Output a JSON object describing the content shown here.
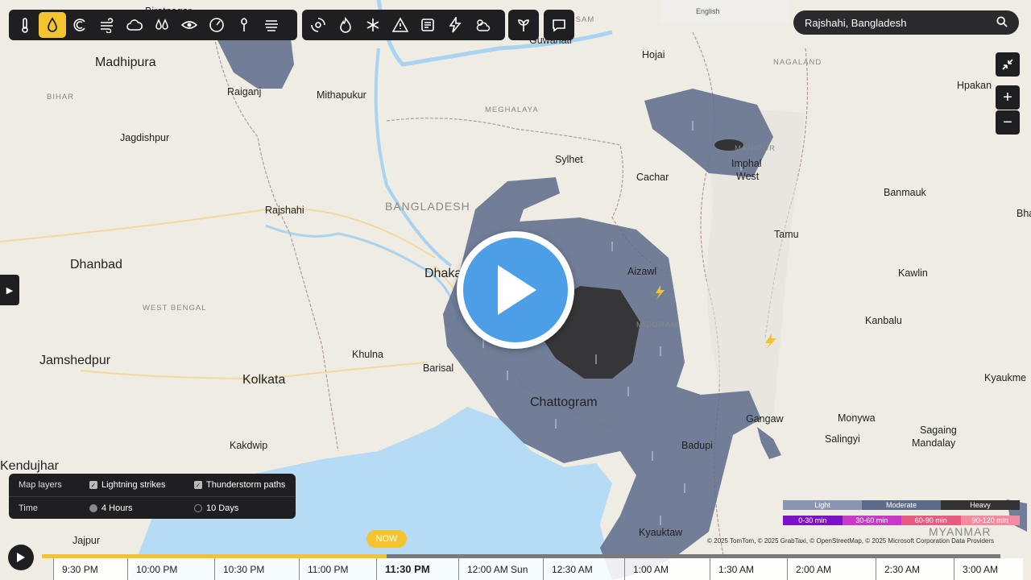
{
  "toolbar": {
    "group1": [
      "thermometer-icon",
      "droplet-icon",
      "wind-gust-icon",
      "wind-icon",
      "cloud-icon",
      "humidity-icon",
      "eye-icon",
      "pressure-gauge-icon",
      "pollen-icon",
      "fog-icon"
    ],
    "group2": [
      "hurricane-icon",
      "fire-icon",
      "snowflake-icon",
      "warning-icon",
      "news-icon",
      "lightning-icon",
      "cloud-sun-icon"
    ],
    "group3": [
      "plant-icon"
    ],
    "group4": [
      "chat-icon"
    ],
    "active": "droplet-icon"
  },
  "language": "English",
  "search": {
    "value": "Rajshahi, Bangladesh"
  },
  "map_labels": [
    {
      "t": "Madhipura",
      "c": "city-lg"
    },
    {
      "t": "Biratnagar",
      "c": "city-sm"
    },
    {
      "t": "Raiganj",
      "c": "city-sm"
    },
    {
      "t": "Mithapukur",
      "c": "city-sm"
    },
    {
      "t": "BIHAR",
      "c": "region"
    },
    {
      "t": "Jagdishpur",
      "c": "city-sm"
    },
    {
      "t": "Rajshahi",
      "c": "city-sm"
    },
    {
      "t": "Dhanbad",
      "c": "city-lg"
    },
    {
      "t": "WEST BENGAL",
      "c": "region"
    },
    {
      "t": "Jamshedpur",
      "c": "city-lg"
    },
    {
      "t": "Kolkata",
      "c": "city-lg"
    },
    {
      "t": "Khulna",
      "c": "city-sm"
    },
    {
      "t": "Barisal",
      "c": "city-sm"
    },
    {
      "t": "Dhaka",
      "c": "city-lg"
    },
    {
      "t": "BANGLADESH",
      "c": "country"
    },
    {
      "t": "Chattogram",
      "c": "city-lg"
    },
    {
      "t": "Kakdwip",
      "c": "city-sm"
    },
    {
      "t": "Kendujhar",
      "c": "city-lg"
    },
    {
      "t": "Jajpur",
      "c": "city-sm"
    },
    {
      "t": "Guwahati",
      "c": "city-sm"
    },
    {
      "t": "ASSAM",
      "c": "region"
    },
    {
      "t": "Hojai",
      "c": "city-sm"
    },
    {
      "t": "MEGHALAYA",
      "c": "region"
    },
    {
      "t": "NAGALAND",
      "c": "region"
    },
    {
      "t": "Sylhet",
      "c": "city-sm"
    },
    {
      "t": "Cachar",
      "c": "city-sm"
    },
    {
      "t": "MANIPUR",
      "c": "region"
    },
    {
      "t": "Imphal",
      "c": "city-sm"
    },
    {
      "t": "West",
      "c": "city-sm"
    },
    {
      "t": "Aizawl",
      "c": "city-sm"
    },
    {
      "t": "MIZORAM",
      "c": "region"
    },
    {
      "t": "Hpakan",
      "c": "city-sm"
    },
    {
      "t": "Banmauk",
      "c": "city-sm"
    },
    {
      "t": "Tamu",
      "c": "city-sm"
    },
    {
      "t": "Kawlin",
      "c": "city-sm"
    },
    {
      "t": "Kanbalu",
      "c": "city-sm"
    },
    {
      "t": "Kyaukme",
      "c": "city-sm"
    },
    {
      "t": "Gangaw",
      "c": "city-sm"
    },
    {
      "t": "Monywa",
      "c": "city-sm"
    },
    {
      "t": "Salingyi",
      "c": "city-sm"
    },
    {
      "t": "Sagaing",
      "c": "city-sm"
    },
    {
      "t": "Mandalay",
      "c": "city-sm"
    },
    {
      "t": "Badupi",
      "c": "city-sm"
    },
    {
      "t": "Kyauktaw",
      "c": "city-sm"
    },
    {
      "t": "MYANMAR",
      "c": "country"
    },
    {
      "t": "Bha",
      "c": "city-sm"
    }
  ],
  "layers": {
    "map_layers_label": "Map layers",
    "lightning": "Lightning strikes",
    "thunderstorm": "Thunderstorm paths",
    "time_label": "Time",
    "hours": "4 Hours",
    "days": "10 Days"
  },
  "legend": {
    "intensity": [
      {
        "label": "Light",
        "color": "#8a95b3"
      },
      {
        "label": "Moderate",
        "color": "#5c6b8a"
      },
      {
        "label": "Heavy",
        "color": "#333"
      }
    ],
    "duration": [
      {
        "label": "0-30 min",
        "color": "#7d10c9"
      },
      {
        "label": "30-60 min",
        "color": "#c53ac9"
      },
      {
        "label": "60-90 min",
        "color": "#e85c82"
      },
      {
        "label": "90-120 min",
        "color": "#f58aa2"
      }
    ]
  },
  "attribution": "© 2025 TomTom, © 2025 GrabTaxi, © OpenStreetMap, © 2025 Microsoft Corporation  Data Providers",
  "timeline": {
    "now_label": "NOW",
    "times": [
      "9:30 PM",
      "10:00 PM",
      "10:30 PM",
      "11:00 PM",
      "11:30 PM",
      "12:00 AM Sun",
      "12:30 AM",
      "1:00 AM",
      "1:30 AM",
      "2:00 AM",
      "2:30 AM",
      "3:00 AM"
    ],
    "current_index": 4
  },
  "colors": {
    "accent": "#f4c430",
    "panel": "#1f1f22",
    "play_overlay": "#4c9fe6",
    "radar": "#5c6b8a",
    "radar_heavy": "#333333"
  }
}
